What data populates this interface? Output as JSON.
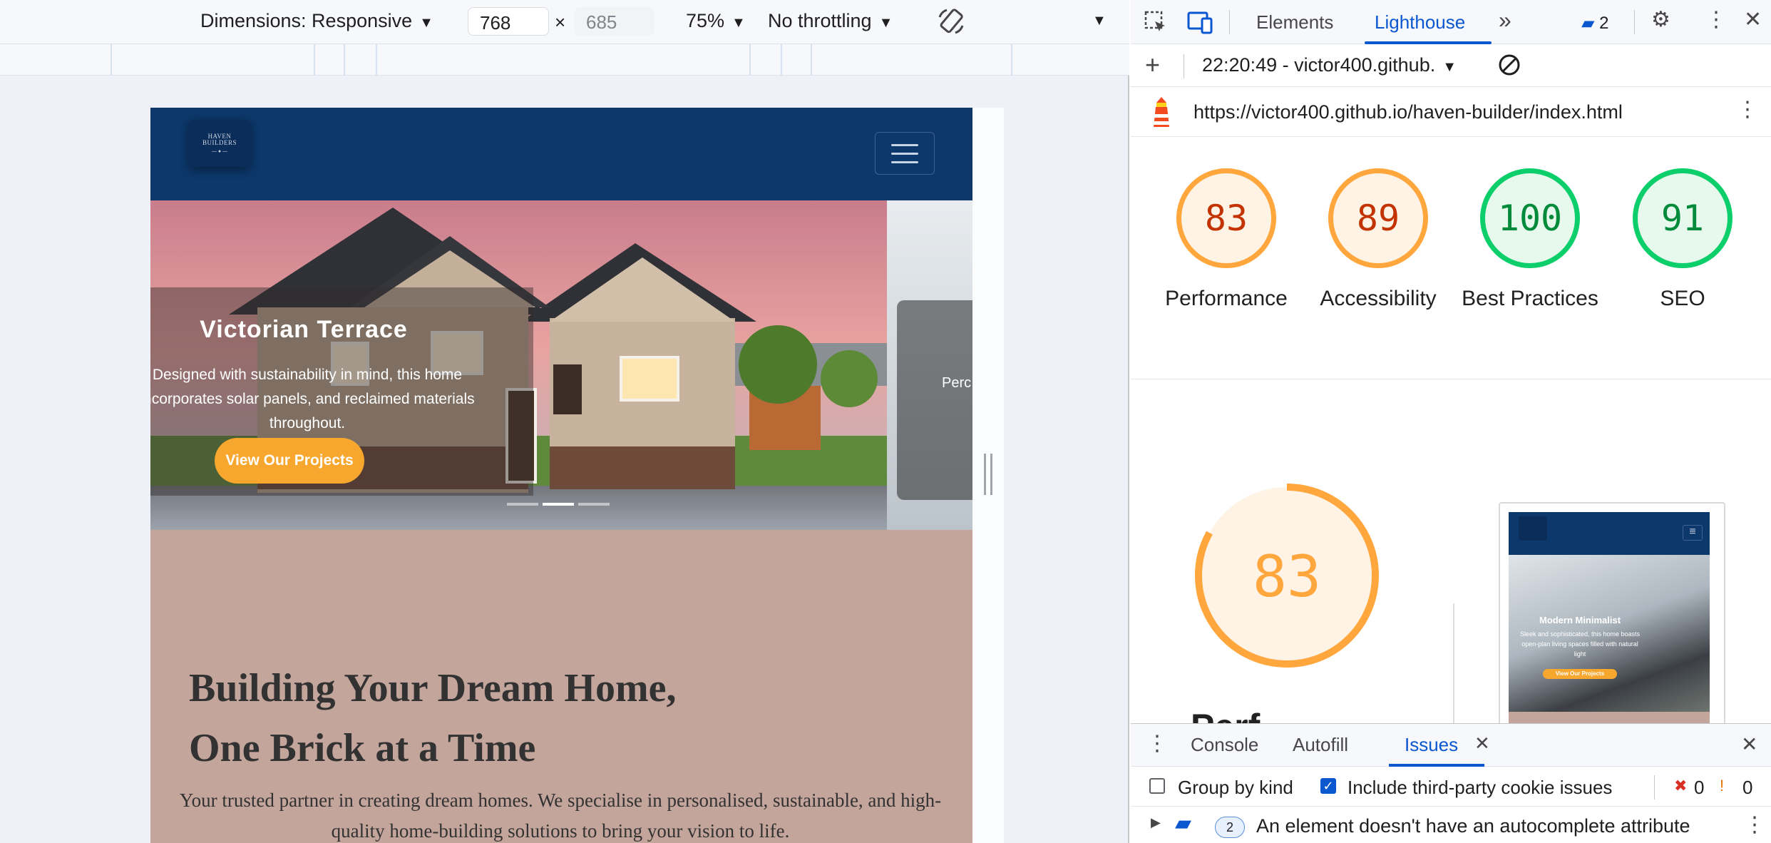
{
  "device_toolbar": {
    "dimensions_label": "Dimensions: Responsive",
    "width_value": "768",
    "height_value": "685",
    "times": "×",
    "zoom": "75%",
    "throttling": "No throttling"
  },
  "site": {
    "slide": {
      "title": "Victorian Terrace",
      "text": "Designed with sustainability in mind, this home incorporates solar panels, and reclaimed materials throughout.",
      "button": "View Our Projects"
    },
    "next_slide_text": "Perc",
    "hero": {
      "title_line1": "Building Your Dream Home,",
      "title_line2": "One Brick at a Time",
      "text": "Your trusted partner in creating dream homes. We specialise in personalised, sustainable, and high-quality home-building solutions to bring your vision to life."
    }
  },
  "devtools": {
    "tabs": [
      "Elements",
      "Lighthouse"
    ],
    "active_tab": "Lighthouse",
    "issues_badge": "2",
    "report_selector": "22:20:49 - victor400.github.",
    "url": "https://victor400.github.io/haven-builder/index.html",
    "scores": [
      {
        "value": "83",
        "label": "Performance",
        "status": "average"
      },
      {
        "value": "89",
        "label": "Accessibility",
        "status": "average"
      },
      {
        "value": "100",
        "label": "Best Practices",
        "status": "pass"
      },
      {
        "value": "91",
        "label": "SEO",
        "status": "pass"
      }
    ],
    "detail": {
      "score": "83",
      "score_fraction": 0.83,
      "label_partial": "Perf"
    },
    "thumbnail": {
      "title": "Modern Minimalist",
      "text": "Sleek and sophisticated, this home boasts open-plan living spaces filled with natural light",
      "button": "View Our Projects"
    },
    "drawer": {
      "tabs": [
        "Console",
        "Autofill",
        "Issues"
      ],
      "active_tab": "Issues",
      "group_by_kind": "Group by kind",
      "include_third_party": "Include third-party cookie issues",
      "error_count": "0",
      "warning_count": "0",
      "issue_count": "2",
      "issue_text": "An element doesn't have an autocomplete attribute"
    }
  },
  "colors": {
    "accent_blue": "#0b57d0",
    "gauge_average": "#ffa63d",
    "gauge_pass": "#0cce6b",
    "site_navy": "#0c386b",
    "site_orange": "#f7a72e",
    "site_mauve": "#c3a59c"
  }
}
